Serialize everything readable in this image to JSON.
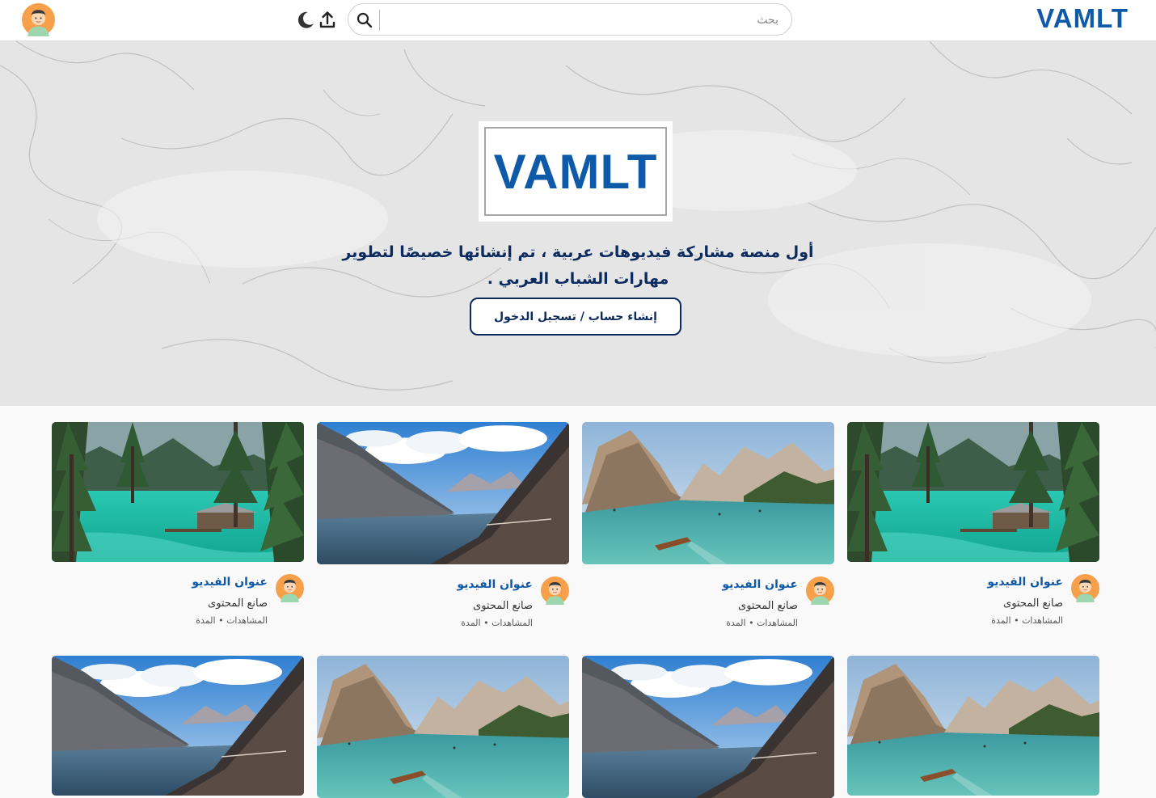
{
  "header": {
    "brand": "VAMLT",
    "search_placeholder": "بحث",
    "icons": [
      "moon-icon",
      "upload-icon",
      "search-icon",
      "user-avatar"
    ]
  },
  "hero": {
    "logo_text": "VAMLT",
    "tagline_line1": "أول منصة مشاركة فيديوهات عربية ، تم إنشائها خصيصًا لتطوير",
    "tagline_line2": "مهارات الشباب العربي .",
    "cta_label": "إنشاء حساب / تسجيل الدخول"
  },
  "videos": [
    {
      "title": "عنوان الفيديو",
      "channel": "صانع المحتوى",
      "meta": "المشاهدات • المدة",
      "scene": "forest-lake"
    },
    {
      "title": "عنوان الفيديو",
      "channel": "صانع المحتوى",
      "meta": "المشاهدات • المدة",
      "scene": "mountain-lake-boat"
    },
    {
      "title": "عنوان الفيديو",
      "channel": "صانع المحتوى",
      "meta": "المشاهدات • المدة",
      "scene": "mountain-valley-lake"
    },
    {
      "title": "عنوان الفيديو",
      "channel": "صانع المحتوى",
      "meta": "المشاهدات • المدة",
      "scene": "forest-lake"
    },
    {
      "title": "",
      "channel": "",
      "meta": "",
      "scene": "mountain-lake-boat"
    },
    {
      "title": "",
      "channel": "",
      "meta": "",
      "scene": "mountain-valley-lake"
    },
    {
      "title": "",
      "channel": "",
      "meta": "",
      "scene": "mountain-lake-boat"
    },
    {
      "title": "",
      "channel": "",
      "meta": "",
      "scene": "mountain-valley-lake"
    }
  ],
  "colors": {
    "brand_blue": "#0f5aa8",
    "navy": "#0b2a5e",
    "page_bg": "#f9f9f9",
    "avatar_orange": "#f7a04b"
  }
}
